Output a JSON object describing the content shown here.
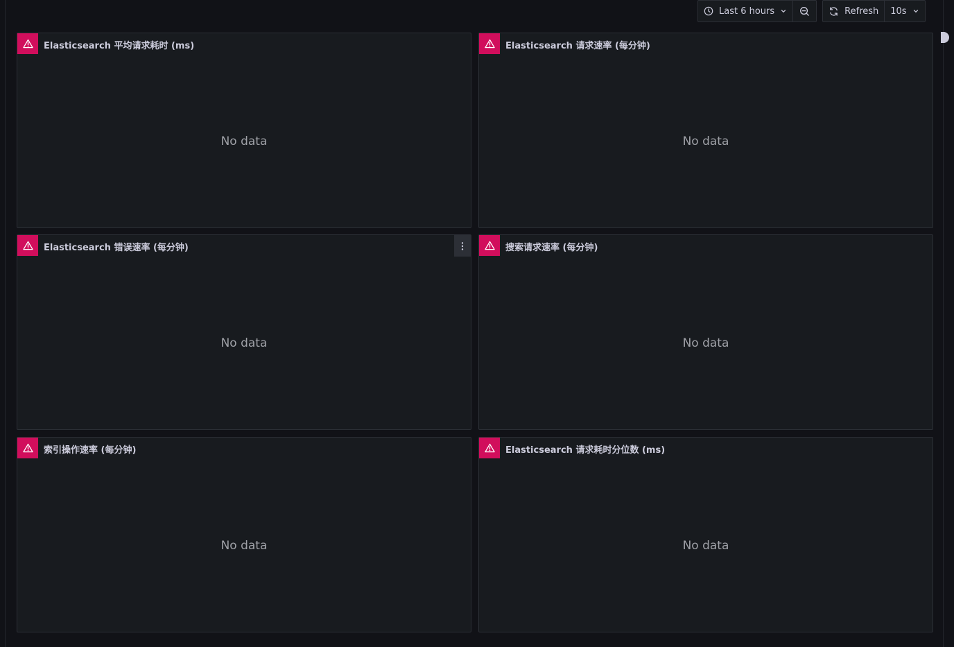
{
  "toolbar": {
    "time_range_label": "Last 6 hours",
    "zoom_out_icon": "zoom-out-icon",
    "refresh_label": "Refresh",
    "refresh_interval_label": "10s"
  },
  "panels": [
    {
      "title": "Elasticsearch 平均请求耗时 (ms)",
      "message": "No data",
      "status": "error"
    },
    {
      "title": "Elasticsearch 请求速率 (每分钟)",
      "message": "No data",
      "status": "error"
    },
    {
      "title": "Elasticsearch 错误速率 (每分钟)",
      "message": "No data",
      "status": "error"
    },
    {
      "title": "搜索请求速率 (每分钟)",
      "message": "No data",
      "status": "error"
    },
    {
      "title": "索引操作速率 (每分钟)",
      "message": "No data",
      "status": "error"
    },
    {
      "title": "Elasticsearch 请求耗时分位数 (ms)",
      "message": "No data",
      "status": "error"
    }
  ],
  "colors": {
    "background": "#111217",
    "panel": "#181b1f",
    "border": "#2c2f36",
    "error": "#d10e5c",
    "text": "#ccccdc",
    "muted": "#9fa1a7"
  }
}
